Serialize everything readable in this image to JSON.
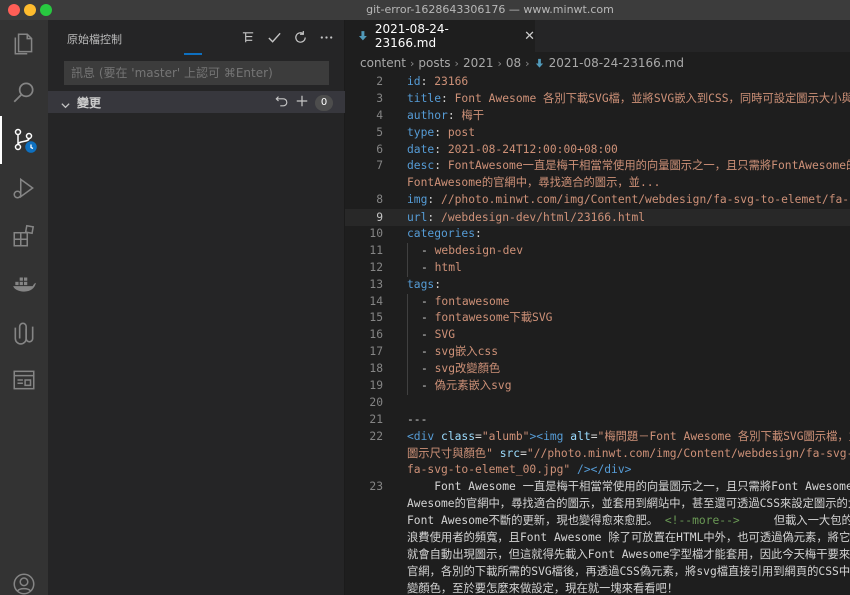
{
  "window": {
    "title": "git-error-1628643306176 — www.minwt.com"
  },
  "activity_bar": {
    "items": [
      "files-icon",
      "search-icon",
      "source-control-icon",
      "run-debug-icon",
      "extensions-icon",
      "docker-icon",
      "paperclip-icon",
      "browser-preview-icon",
      "account-icon"
    ]
  },
  "sidebar": {
    "title": "原始檔控制",
    "message_placeholder": "訊息 (要在 'master' 上認可 ⌘Enter)",
    "changes_label": "變更",
    "changes_count": "0"
  },
  "editor": {
    "tab_label": "2021-08-24-23166.md",
    "breadcrumbs": [
      "content",
      "posts",
      "2021",
      "08",
      "2021-08-24-23166.md"
    ],
    "current_line": "9",
    "lines": [
      {
        "n": "2",
        "key": "id",
        "val": "23166"
      },
      {
        "n": "3",
        "key": "title",
        "val": "Font Awesome 各別下載SVG檔，並將SVG嵌入到CSS，同時可設定圖示大小與"
      },
      {
        "n": "4",
        "key": "author",
        "val": "梅干"
      },
      {
        "n": "5",
        "key": "type",
        "val": "post"
      },
      {
        "n": "6",
        "key": "date",
        "val": "2021-08-24T12:00:00+08:00"
      },
      {
        "n": "7",
        "key": "desc",
        "val": "FontAwesome一直是梅干相當常使用的向量圖示之一，且只需將FontAwesome的"
      },
      {
        "n": "",
        "key": "",
        "val": "FontAwesome的官網中，尋找適合的圖示，並..."
      },
      {
        "n": "8",
        "key": "img",
        "val": "//photo.minwt.com/img/Content/webdesign/fa-svg-to-elemet/fa-s"
      },
      {
        "n": "9",
        "key": "url",
        "val": "/webdesign-dev/html/23166.html"
      },
      {
        "n": "10",
        "key": "categories",
        "val": ""
      },
      {
        "n": "11",
        "item": "webdesign-dev"
      },
      {
        "n": "12",
        "item": "html"
      },
      {
        "n": "13",
        "key": "tags",
        "val": ""
      },
      {
        "n": "14",
        "item": "fontawesome"
      },
      {
        "n": "15",
        "item": "fontawesome下載SVG"
      },
      {
        "n": "16",
        "item": "SVG"
      },
      {
        "n": "17",
        "item": "svg嵌入css"
      },
      {
        "n": "18",
        "item": "svg改變顏色"
      },
      {
        "n": "19",
        "item": "偽元素嵌入svg"
      },
      {
        "n": "20",
        "plain": ""
      },
      {
        "n": "21",
        "plain": "---"
      }
    ],
    "line22": {
      "n": "22",
      "div_open": "<div",
      "class_attr": "class",
      "class_val": "\"alumb\"",
      "img_open": "><img",
      "alt_attr": "alt",
      "alt_val": "\"梅問題－Font Awesome 各別下載SVG圖示檔，並",
      "alt_val2": "圖示尺寸與顏色\"",
      "src_attr": "src",
      "src_val": "\"//photo.minwt.com/img/Content/webdesign/fa-svg-t",
      "src_val2": "fa-svg-to-elemet_00.jpg\"",
      "close": " /></div>"
    },
    "line23": {
      "n": "23",
      "p1": "    Font Awesome 一直是梅干相當常使用的向量圖示之一，且只需將Font Awesome的",
      "p2": "Awesome的官網中，尋找適合的圖示，並套用到網站中，甚至還可透過CSS來設定圖示的大",
      "p3a": "Font Awesome不斷的更新，現也變得愈來愈肥。 ",
      "p3cmt": "<!--more-->",
      "p3b": "     但載入一大包的圖",
      "p4": "浪費使用者的頻寬，且Font Awesome 除了可放置在HTML中外，也可透過偽元素，將它",
      "p5": "就會自動出現圖示，但這就得先載入Font Awesome字型檔才能套用，因此今天梅干要來",
      "p6": "官網，各別的下載所需的SVG檔後，再透過CSS偽元素，將svg檔直接引用到網頁的CSS中",
      "p7": "變顏色，至於要怎麼來做設定，現在就一塊來看看吧！"
    }
  }
}
